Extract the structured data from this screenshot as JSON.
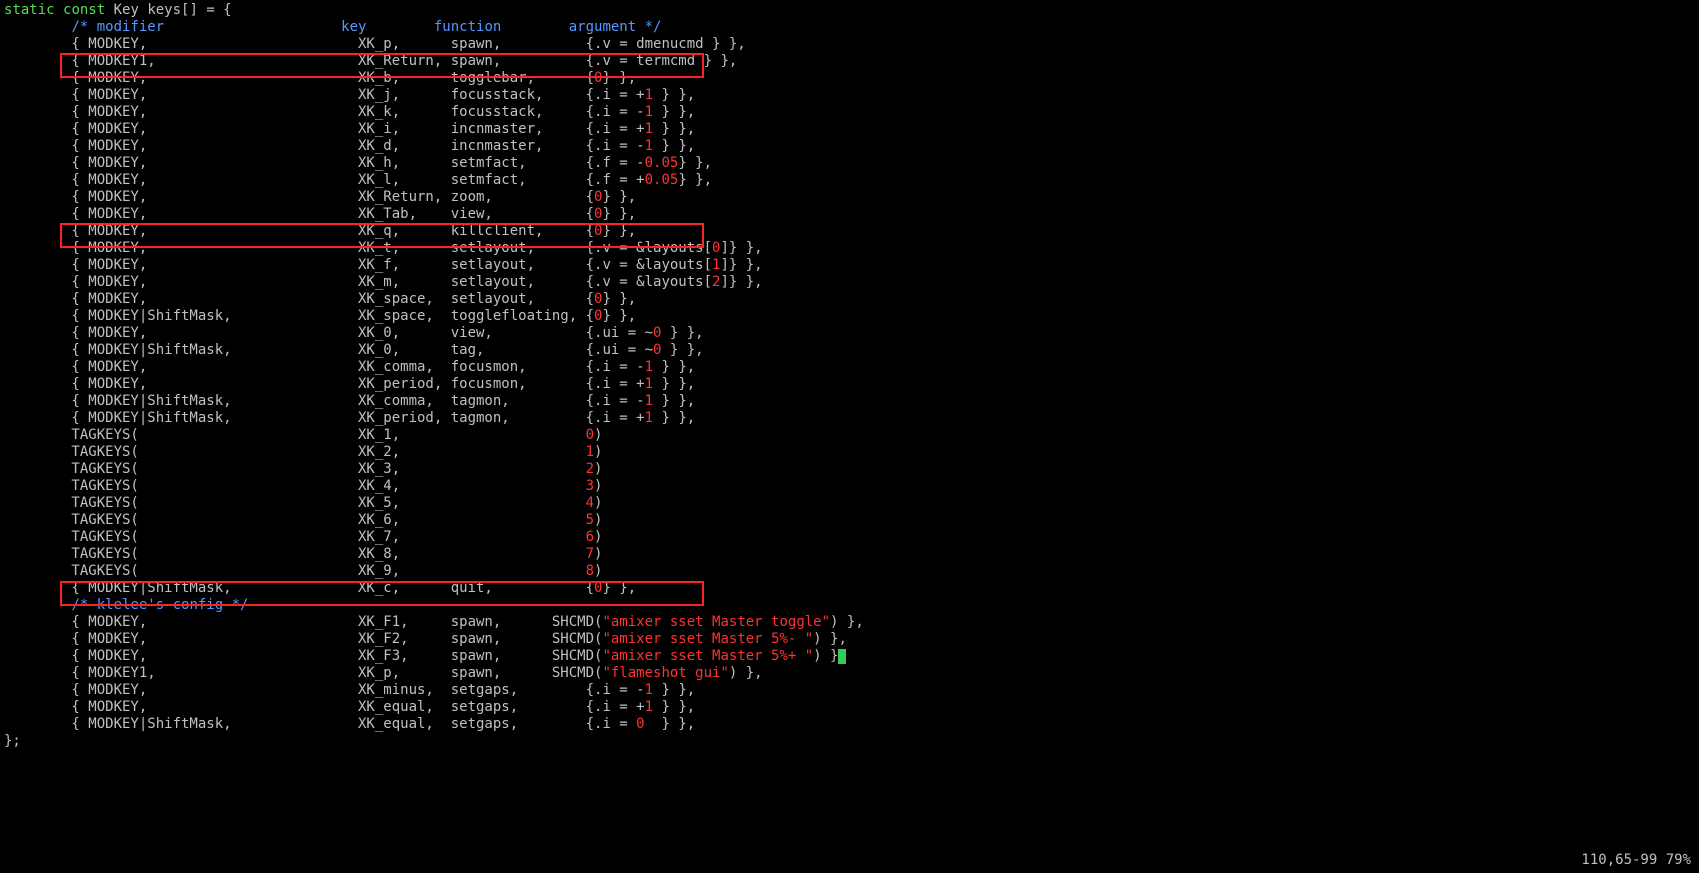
{
  "decl": {
    "static": "static",
    "const": "const",
    "type": "Key",
    "name": "keys[] = {"
  },
  "header_comment": "/* modifier                     key        function        argument */",
  "rows": [
    {
      "mod": "MODKEY,",
      "key": "XK_p,",
      "fn": "spawn,",
      "argpre": "{.v = dmenucmd } },",
      "num": ""
    },
    {
      "mod": "MODKEY1,",
      "key": "XK_Return,",
      "fn": "spawn,",
      "argpre": "{.v = termcmd } },",
      "num": ""
    },
    {
      "mod": "MODKEY,",
      "key": "XK_b,",
      "fn": "togglebar,",
      "argpre": "{",
      "num": "0",
      "argpost": "} },"
    },
    {
      "mod": "MODKEY,",
      "key": "XK_j,",
      "fn": "focusstack,",
      "argpre": "{.i = +",
      "num": "1",
      "argpost": " } },"
    },
    {
      "mod": "MODKEY,",
      "key": "XK_k,",
      "fn": "focusstack,",
      "argpre": "{.i = -",
      "num": "1",
      "argpost": " } },"
    },
    {
      "mod": "MODKEY,",
      "key": "XK_i,",
      "fn": "incnmaster,",
      "argpre": "{.i = +",
      "num": "1",
      "argpost": " } },"
    },
    {
      "mod": "MODKEY,",
      "key": "XK_d,",
      "fn": "incnmaster,",
      "argpre": "{.i = -",
      "num": "1",
      "argpost": " } },"
    },
    {
      "mod": "MODKEY,",
      "key": "XK_h,",
      "fn": "setmfact,",
      "argpre": "{.f = -",
      "num": "0.05",
      "argpost": "} },"
    },
    {
      "mod": "MODKEY,",
      "key": "XK_l,",
      "fn": "setmfact,",
      "argpre": "{.f = +",
      "num": "0.05",
      "argpost": "} },"
    },
    {
      "mod": "MODKEY,",
      "key": "XK_Return,",
      "fn": "zoom,",
      "argpre": "{",
      "num": "0",
      "argpost": "} },"
    },
    {
      "mod": "MODKEY,",
      "key": "XK_Tab,",
      "fn": "view,",
      "argpre": "{",
      "num": "0",
      "argpost": "} },"
    },
    {
      "mod": "MODKEY,",
      "key": "XK_q,",
      "fn": "killclient,",
      "argpre": "{",
      "num": "0",
      "argpost": "} },"
    },
    {
      "mod": "MODKEY,",
      "key": "XK_t,",
      "fn": "setlayout,",
      "argpre": "{.v = &layouts[",
      "num": "0",
      "argpost": "]} },"
    },
    {
      "mod": "MODKEY,",
      "key": "XK_f,",
      "fn": "setlayout,",
      "argpre": "{.v = &layouts[",
      "num": "1",
      "argpost": "]} },"
    },
    {
      "mod": "MODKEY,",
      "key": "XK_m,",
      "fn": "setlayout,",
      "argpre": "{.v = &layouts[",
      "num": "2",
      "argpost": "]} },"
    },
    {
      "mod": "MODKEY,",
      "key": "XK_space,",
      "fn": "setlayout,",
      "argpre": "{",
      "num": "0",
      "argpost": "} },"
    },
    {
      "mod": "MODKEY|ShiftMask,",
      "key": "XK_space,",
      "fn": "togglefloating,",
      "argpre": "{",
      "num": "0",
      "argpost": "} },"
    },
    {
      "mod": "MODKEY,",
      "key": "XK_0,",
      "fn": "view,",
      "argpre": "{.ui = ~",
      "num": "0",
      "argpost": " } },"
    },
    {
      "mod": "MODKEY|ShiftMask,",
      "key": "XK_0,",
      "fn": "tag,",
      "argpre": "{.ui = ~",
      "num": "0",
      "argpost": " } },"
    },
    {
      "mod": "MODKEY,",
      "key": "XK_comma,",
      "fn": "focusmon,",
      "argpre": "{.i = -",
      "num": "1",
      "argpost": " } },"
    },
    {
      "mod": "MODKEY,",
      "key": "XK_period,",
      "fn": "focusmon,",
      "argpre": "{.i = +",
      "num": "1",
      "argpost": " } },"
    },
    {
      "mod": "MODKEY|ShiftMask,",
      "key": "XK_comma,",
      "fn": "tagmon,",
      "argpre": "{.i = -",
      "num": "1",
      "argpost": " } },"
    },
    {
      "mod": "MODKEY|ShiftMask,",
      "key": "XK_period,",
      "fn": "tagmon,",
      "argpre": "{.i = +",
      "num": "1",
      "argpost": " } },"
    }
  ],
  "tagkeys": [
    {
      "key": "XK_1,",
      "n": "0"
    },
    {
      "key": "XK_2,",
      "n": "1"
    },
    {
      "key": "XK_3,",
      "n": "2"
    },
    {
      "key": "XK_4,",
      "n": "3"
    },
    {
      "key": "XK_5,",
      "n": "4"
    },
    {
      "key": "XK_6,",
      "n": "5"
    },
    {
      "key": "XK_7,",
      "n": "6"
    },
    {
      "key": "XK_8,",
      "n": "7"
    },
    {
      "key": "XK_9,",
      "n": "8"
    }
  ],
  "quitrow": {
    "mod": "MODKEY|ShiftMask,",
    "key": "XK_c,",
    "fn": "quit,",
    "num": "0"
  },
  "comment2": "/* klelee's config */",
  "shcmds": [
    {
      "mod": "MODKEY,",
      "key": "XK_F1,",
      "fn": "spawn,",
      "pre": "SHCMD(",
      "str": "\"amixer sset Master toggle\"",
      "post": ") },"
    },
    {
      "mod": "MODKEY,",
      "key": "XK_F2,",
      "fn": "spawn,",
      "pre": "SHCMD(",
      "str": "\"amixer sset Master 5%- \"",
      "post": ") },"
    },
    {
      "mod": "MODKEY,",
      "key": "XK_F3,",
      "fn": "spawn,",
      "pre": "SHCMD(",
      "str": "\"amixer sset Master 5%+ \"",
      "post": ") }",
      "cursor": true
    },
    {
      "mod": "MODKEY1,",
      "key": "XK_p,",
      "fn": "spawn,",
      "pre": "SHCMD(",
      "str": "\"flameshot gui\"",
      "post": ") },"
    }
  ],
  "gaps": [
    {
      "mod": "MODKEY,",
      "key": "XK_minus,",
      "fn": "setgaps,",
      "argpre": "{.i = -",
      "num": "1",
      "argpost": " } },"
    },
    {
      "mod": "MODKEY,",
      "key": "XK_equal,",
      "fn": "setgaps,",
      "argpre": "{.i = +",
      "num": "1",
      "argpost": " } },"
    },
    {
      "mod": "MODKEY|ShiftMask,",
      "key": "XK_equal,",
      "fn": "setgaps,",
      "argpre": "{.i = ",
      "num": "0",
      "argpost": "  } },"
    }
  ],
  "close": "};",
  "status": "110,65-99     79%",
  "cols": {
    "mod": 32,
    "key": 11,
    "fn": 16
  },
  "indent": "        "
}
